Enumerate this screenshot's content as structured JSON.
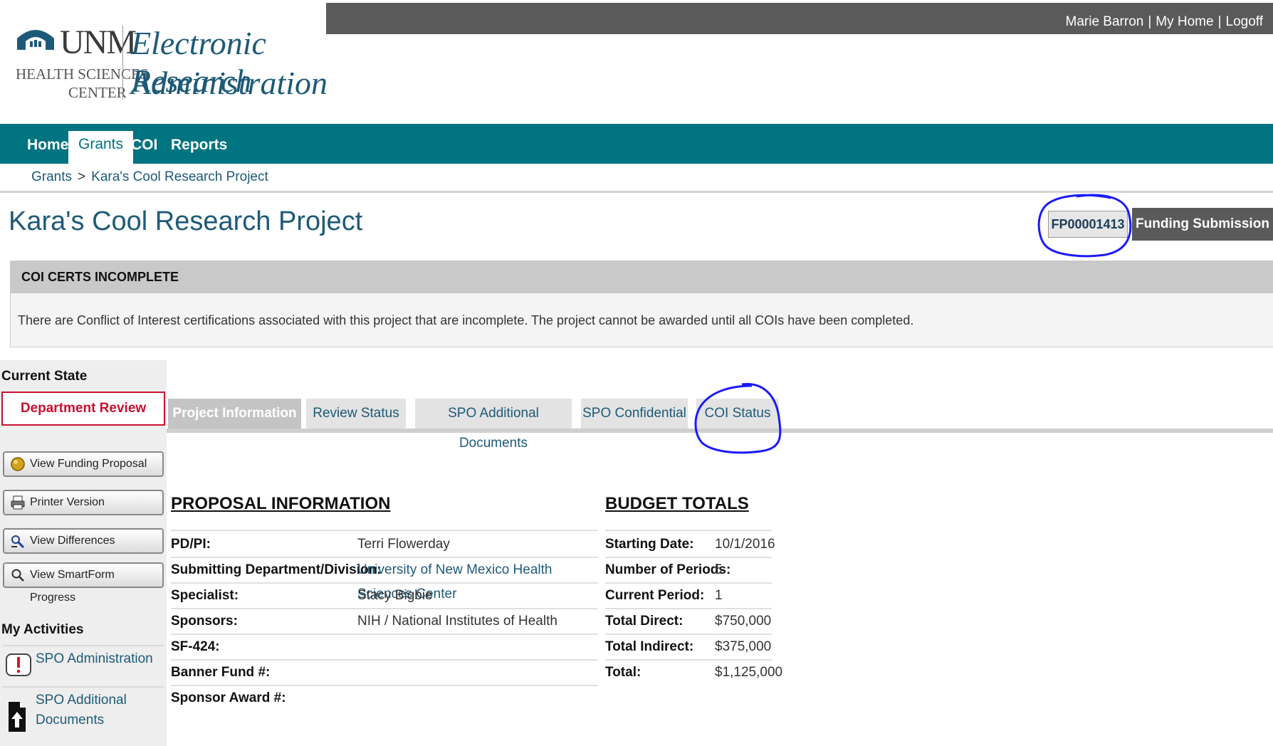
{
  "header": {
    "user_name": "Marie Barron",
    "my_home": "My Home",
    "logoff": "Logoff",
    "logo": {
      "unm": "UNM",
      "hsc_line1": "HEALTH SCIENCES",
      "hsc_line2": "CENTER",
      "app_line1": "Electronic Research",
      "app_line2": "Administration"
    }
  },
  "nav": {
    "items": [
      {
        "label": "Home"
      },
      {
        "label": "Grants"
      },
      {
        "label": "COI"
      },
      {
        "label": "Reports"
      }
    ],
    "active": "Grants"
  },
  "breadcrumb": {
    "items": [
      "Grants",
      "Kara's Cool Research Project"
    ],
    "separator": ">"
  },
  "project": {
    "title": "Kara's Cool Research Project",
    "id": "FP00001413",
    "type": "Funding Submission"
  },
  "alert": {
    "heading": "COI CERTS INCOMPLETE",
    "message": "There are Conflict of Interest certifications associated with this project that are incomplete.  The project cannot be awarded until all COIs have been completed."
  },
  "sidebar": {
    "current_state_label": "Current State",
    "current_state": "Department Review",
    "buttons": [
      {
        "label": "View Funding Proposal",
        "icon": "funding-proposal-icon"
      },
      {
        "label": "Printer Version",
        "icon": "printer-icon"
      },
      {
        "label": "View Differences",
        "icon": "differences-icon"
      },
      {
        "label": "View SmartForm Progress",
        "icon": "search-icon"
      }
    ],
    "activities_label": "My Activities",
    "activities": [
      {
        "label": "SPO Administration",
        "icon": "alert-icon"
      },
      {
        "label_line1": "SPO Additional",
        "label_line2": "Documents",
        "icon": "upload-document-icon"
      }
    ]
  },
  "tabs": [
    {
      "label": "Project Information",
      "active": true
    },
    {
      "label": "Review Status"
    },
    {
      "label": "SPO Additional Documents"
    },
    {
      "label": "SPO Confidential"
    },
    {
      "label": "COI Status"
    }
  ],
  "proposal_info": {
    "title": "PROPOSAL INFORMATION",
    "rows": [
      {
        "label": "PD/PI:",
        "value": "Terri Flowerday"
      },
      {
        "label": "Submitting Department/Division:",
        "value": "University of New Mexico Health Sciences Center"
      },
      {
        "label": "Specialist:",
        "value": "Stacy Bigbie"
      },
      {
        "label": "Sponsors:",
        "value": "NIH / National Institutes of Health"
      },
      {
        "label": "SF-424:",
        "value": ""
      },
      {
        "label": "Banner Fund #:",
        "value": ""
      },
      {
        "label": "Sponsor Award #:",
        "value": ""
      }
    ]
  },
  "budget_totals": {
    "title": "BUDGET TOTALS",
    "rows": [
      {
        "label": "Starting Date:",
        "value": "10/1/2016"
      },
      {
        "label": "Number of Periods:",
        "value": "5"
      },
      {
        "label": "Current Period:",
        "value": "1"
      },
      {
        "label": "Total Direct:",
        "value": "$750,000"
      },
      {
        "label": "Total Indirect:",
        "value": "$375,000"
      },
      {
        "label": "Total:",
        "value": "$1,125,000"
      }
    ]
  },
  "colors": {
    "nav_teal": "#007480",
    "link_blue": "#1d5a78",
    "state_red": "#c8102e",
    "annotation_blue": "#1a1aff"
  }
}
